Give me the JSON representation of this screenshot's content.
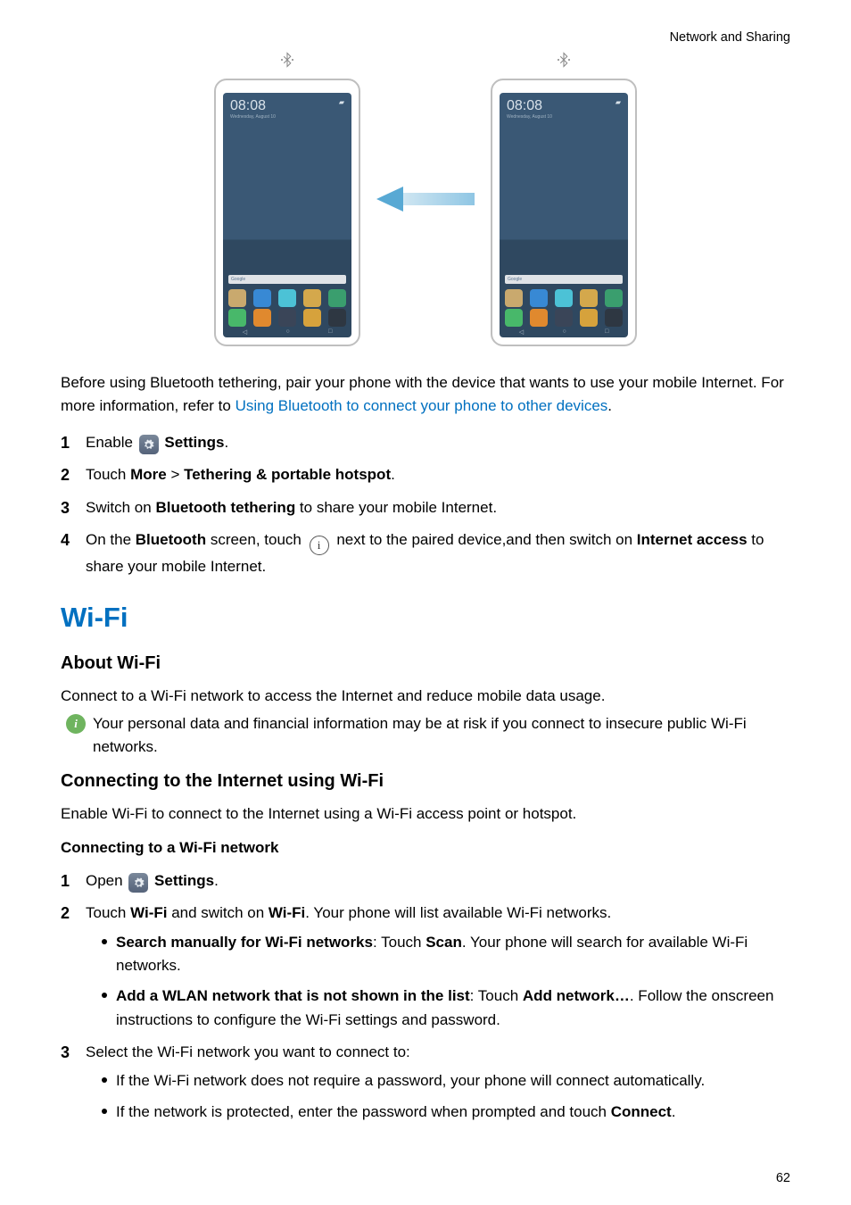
{
  "header": {
    "breadcrumb": "Network and Sharing"
  },
  "figure": {
    "bt_glyph": "⋅⧐⋅",
    "phone_time": "08:08",
    "phone_date": "Wednesday, August 10",
    "search_label": "Google"
  },
  "intro": {
    "p1a": "Before using Bluetooth tethering, pair your phone with the device that wants to use your mobile Internet. For more information, refer to ",
    "p1link": "Using Bluetooth to connect your phone to other devices",
    "p1b": "."
  },
  "steps1": {
    "s1a": "Enable ",
    "s1b": "Settings",
    "s1c": ".",
    "s2a": "Touch ",
    "s2b": "More",
    "s2c": " > ",
    "s2d": "Tethering & portable hotspot",
    "s2e": ".",
    "s3a": "Switch on ",
    "s3b": "Bluetooth tethering",
    "s3c": " to share your mobile Internet.",
    "s4a": "On the ",
    "s4b": "Bluetooth",
    "s4c": " screen, touch ",
    "s4d": " next to the paired device,and then switch on ",
    "s4e": "Internet access",
    "s4f": " to share your mobile Internet."
  },
  "wifi": {
    "title": "Wi-Fi",
    "about_h": "About Wi-Fi",
    "about_p": "Connect to a Wi-Fi network to access the Internet and reduce mobile data usage.",
    "info": "Your personal data and financial information may be at risk if you connect to insecure public Wi-Fi networks.",
    "conn_h": "Connecting to the Internet using Wi-Fi",
    "conn_p": "Enable Wi-Fi to connect to the Internet using a Wi-Fi access point or hotspot.",
    "conn_net_h": "Connecting to a Wi-Fi network"
  },
  "steps2": {
    "s1a": "Open ",
    "s1b": "Settings",
    "s1c": ".",
    "s2a": "Touch ",
    "s2b": "Wi-Fi",
    "s2c": " and switch on ",
    "s2d": "Wi-Fi",
    "s2e": ". Your phone will list available Wi-Fi networks.",
    "b1a": "Search manually for Wi-Fi networks",
    "b1b": ": Touch ",
    "b1c": "Scan",
    "b1d": ". Your phone will search for available Wi-Fi networks.",
    "b2a": "Add a WLAN network that is not shown in the list",
    "b2b": ": Touch ",
    "b2c": "Add network…",
    "b2d": ". Follow the onscreen instructions to configure the Wi-Fi settings and password.",
    "s3a": "Select the Wi-Fi network you want to connect to:",
    "b3": "If the Wi-Fi network does not require a password, your phone will connect automatically.",
    "b4a": "If the network is protected, enter the password when prompted and touch ",
    "b4b": "Connect",
    "b4c": "."
  },
  "circle_i_glyph": "i",
  "page_number": "62"
}
